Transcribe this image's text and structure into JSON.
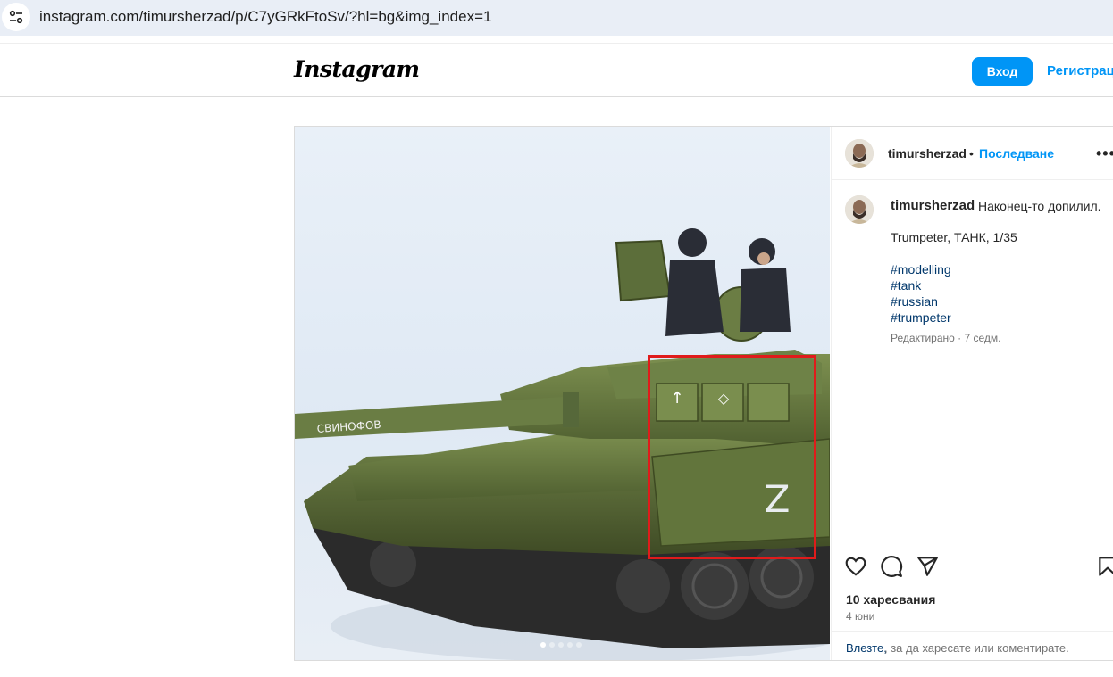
{
  "browser": {
    "url": "instagram.com/timursherzad/p/C7yGRkFtoSv/?hl=bg&img_index=1"
  },
  "header": {
    "logo": "Instagram",
    "login_label": "Вход",
    "register_label": "Регистрац"
  },
  "post": {
    "username": "timursherzad",
    "separator": "•",
    "follow_label": "Последване",
    "more_label": "•••",
    "caption_username": "timursherzad",
    "caption_text": "Наконец-то допилил.",
    "caption_line2": "Trumpeter, ТАНК, 1/35",
    "hashtags": [
      "#modelling",
      "#tank",
      "#russian",
      "#trumpeter"
    ],
    "edited": "Редактирано · 7 седм.",
    "likes": "10 харесвания",
    "date": "4 юни",
    "login_link": "Влезте,",
    "login_rest": ", за да харесате или коментирате.",
    "image_text": {
      "barrel_text": "СВИНОФОВ",
      "armor_letter": "Z"
    },
    "carousel": {
      "count": 5,
      "active_index": 0
    }
  },
  "icons": [
    "site-info-icon",
    "heart-icon",
    "comment-icon",
    "share-icon",
    "bookmark-icon"
  ],
  "colors": {
    "accent": "#0095f6",
    "hashtag": "#00376b",
    "highlight": "#e01b1b",
    "address_bar": "#e9eef6"
  }
}
